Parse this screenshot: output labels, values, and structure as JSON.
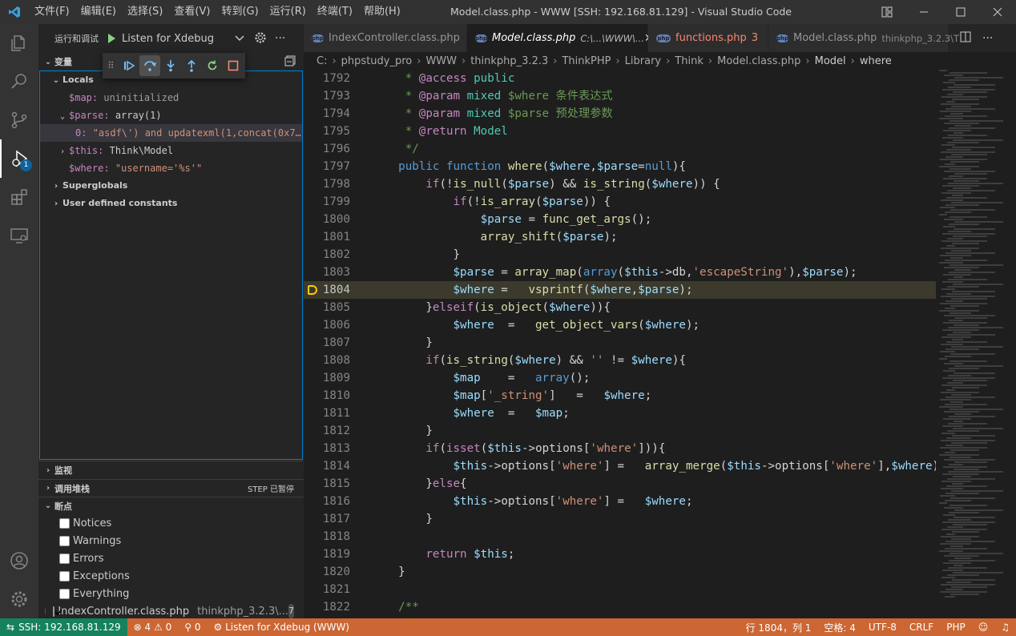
{
  "menu": [
    "文件(F)",
    "编辑(E)",
    "选择(S)",
    "查看(V)",
    "转到(G)",
    "运行(R)",
    "终端(T)",
    "帮助(H)"
  ],
  "window_title": "Model.class.php - WWW [SSH: 192.168.81.129] - Visual Studio Code",
  "sidebar": {
    "title": "运行和调试",
    "launch": "Listen for Xdebug",
    "variables": "变量",
    "watch": "监视",
    "callstack": "调用堆栈",
    "callstack_status": "STEP 已暂停",
    "breakpoints": "断点"
  },
  "variables": {
    "locals": "Locals",
    "map_name": "$map:",
    "map_val": "uninitialized",
    "parse_name": "$parse:",
    "parse_val": "array(1)",
    "parse0_name": "0:",
    "parse0_val": "\"asdf\\') and updatexml(1,concat(0x7…",
    "this_name": "$this:",
    "this_val": "Think\\Model",
    "where_name": "$where:",
    "where_val": "\"username='%s'\"",
    "superglobals": "Superglobals",
    "constants": "User defined constants"
  },
  "breakpoints": {
    "notices": "Notices",
    "warnings": "Warnings",
    "errors": "Errors",
    "exceptions": "Exceptions",
    "everything": "Everything",
    "file": "IndexController.class.php",
    "file_path": "thinkphp_3.2.3\\...",
    "file_count": "7"
  },
  "tabs": [
    {
      "label": "IndexController.class.php"
    },
    {
      "label": "Model.class.php",
      "desc": "C:\\...\\WWW\\..."
    },
    {
      "label": "functions.php",
      "count": "3"
    },
    {
      "label": "Model.class.php",
      "desc": "thinkphp_3.2.3\\T"
    }
  ],
  "breadcrumb": [
    "C:",
    "phpstudy_pro",
    "WWW",
    "thinkphp_3.2.3",
    "ThinkPHP",
    "Library",
    "Think",
    "Model.class.php",
    "Model",
    "where"
  ],
  "code_lines": [
    [
      "1792",
      "     * @access public"
    ],
    [
      "1793",
      "     * @param mixed $where 条件表达式"
    ],
    [
      "1794",
      "     * @param mixed $parse 预处理参数"
    ],
    [
      "1795",
      "     * @return Model"
    ],
    [
      "1796",
      "     */"
    ],
    [
      "1797",
      "    public function where($where,$parse=null){"
    ],
    [
      "1798",
      "        if(!is_null($parse) && is_string($where)) {"
    ],
    [
      "1799",
      "            if(!is_array($parse)) {"
    ],
    [
      "1800",
      "                $parse = func_get_args();"
    ],
    [
      "1801",
      "                array_shift($parse);"
    ],
    [
      "1802",
      "            }"
    ],
    [
      "1803",
      "            $parse = array_map(array($this->db,'escapeString'),$parse);"
    ],
    [
      "1804",
      "            $where =   vsprintf($where,$parse);"
    ],
    [
      "1805",
      "        }elseif(is_object($where)){"
    ],
    [
      "1806",
      "            $where  =   get_object_vars($where);"
    ],
    [
      "1807",
      "        }"
    ],
    [
      "1808",
      "        if(is_string($where) && '' != $where){"
    ],
    [
      "1809",
      "            $map    =   array();"
    ],
    [
      "1810",
      "            $map['_string']   =   $where;"
    ],
    [
      "1811",
      "            $where  =   $map;"
    ],
    [
      "1812",
      "        }"
    ],
    [
      "1813",
      "        if(isset($this->options['where'])){"
    ],
    [
      "1814",
      "            $this->options['where'] =   array_merge($this->options['where'],$where);"
    ],
    [
      "1815",
      "        }else{"
    ],
    [
      "1816",
      "            $this->options['where'] =   $where;"
    ],
    [
      "1817",
      "        }"
    ],
    [
      "1818",
      ""
    ],
    [
      "1819",
      "        return $this;"
    ],
    [
      "1820",
      "    }"
    ],
    [
      "1821",
      ""
    ],
    [
      "1822",
      "    /**"
    ]
  ],
  "current_line": "1804",
  "status": {
    "remote": "SSH: 192.168.81.129",
    "errors": "4",
    "warnings": "0",
    "ports": "0",
    "debug": "Listen for Xdebug (WWW)",
    "position": "行 1804，列 1",
    "spaces": "空格: 4",
    "encoding": "UTF-8",
    "eol": "CRLF",
    "lang": "PHP"
  },
  "colors": {
    "statusbar": "#cc6633",
    "remote": "#16825d",
    "accent": "#007acc"
  }
}
